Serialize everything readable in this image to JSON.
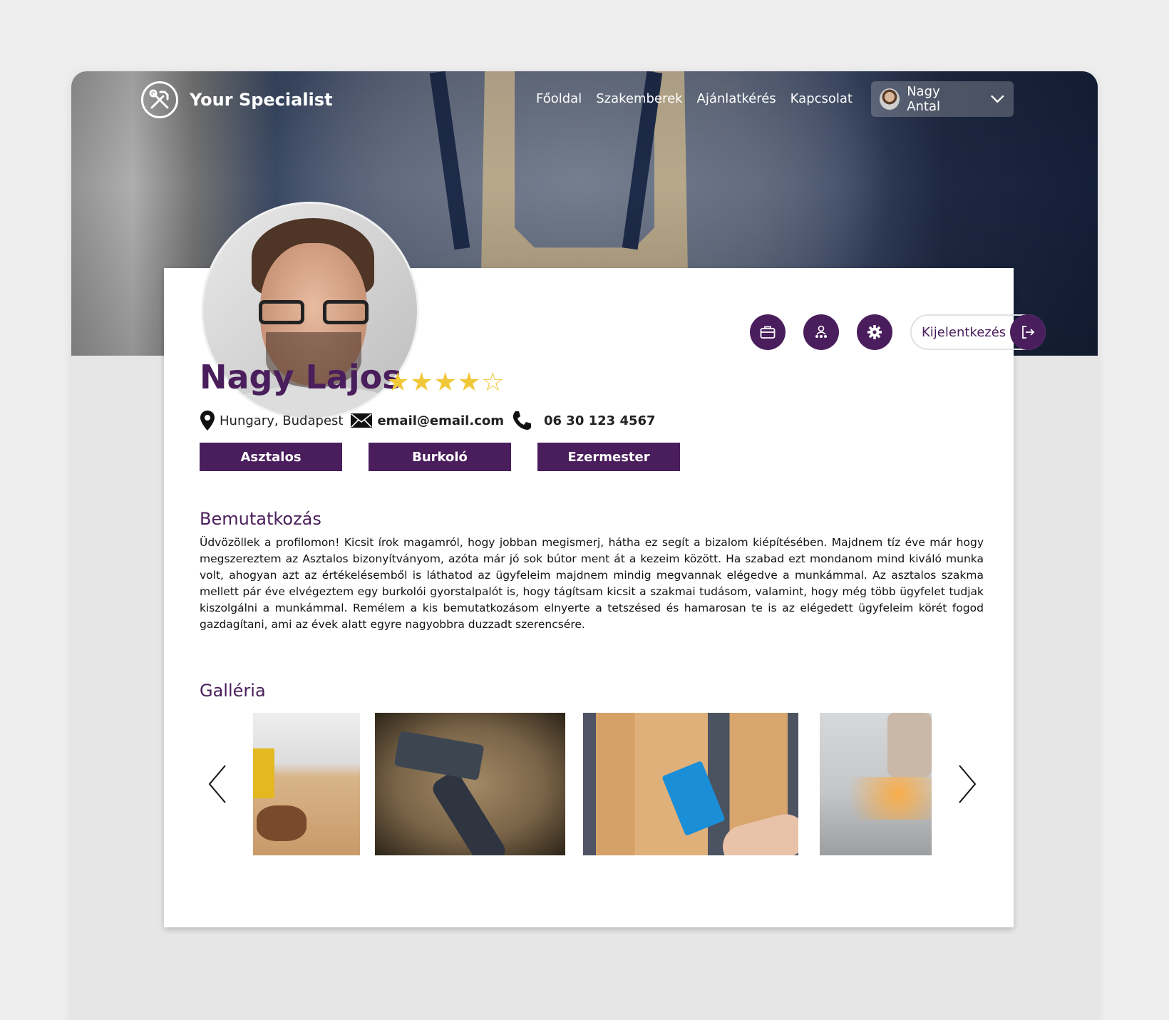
{
  "nav": {
    "brand": "Your Specialist",
    "brand_icon": "tools-icon",
    "links": [
      "Főoldal",
      "Szakemberek",
      "Ajánlatkérés",
      "Kapcsolat"
    ],
    "user_name": "Nagy Antal"
  },
  "profile": {
    "name": "Nagy Lajos",
    "rating": 4,
    "rating_max": 5,
    "stars": "★★★★☆",
    "location": "Hungary, Budapest",
    "email": "email@email.com",
    "phone": "06 30 123 4567",
    "tags": [
      "Asztalos",
      "Burkoló",
      "Ezermester"
    ]
  },
  "actions": {
    "logout_label": "Kijelentkezés"
  },
  "about": {
    "title": "Bemutatkozás",
    "text": "Üdvözöllek a profilomon! Kicsit írok magamról, hogy jobban megismerj, hátha ez segít a bizalom kiépítésében. Majdnem tíz éve már hogy megszereztem az Asztalos bizonyítványom, azóta már jó sok bútor ment át a kezeim között. Ha szabad ezt mondanom mind kiváló munka volt, ahogyan azt az értékelésemből is láthatod az ügyfeleim majdnem mindig megvannak elégedve a munkámmal. Az asztalos szakma mellett pár éve elvégeztem egy burkolói gyorstalpalót is, hogy tágítsam kicsit a szakmai tudásom, valamint, hogy még több ügyfelet tudjak kiszolgálni a munkámmal. Remélem a kis bemutatkozásom elnyerte a tetszésed és hamarosan te is az elégedett ügyfeleim körét fogod gazdagítani, ami az évek alatt egyre nagyobbra duzzadt szerencsére."
  },
  "gallery": {
    "title": "Galléria"
  },
  "colors": {
    "accent": "#4a1e5c",
    "star": "#f1c83a"
  }
}
